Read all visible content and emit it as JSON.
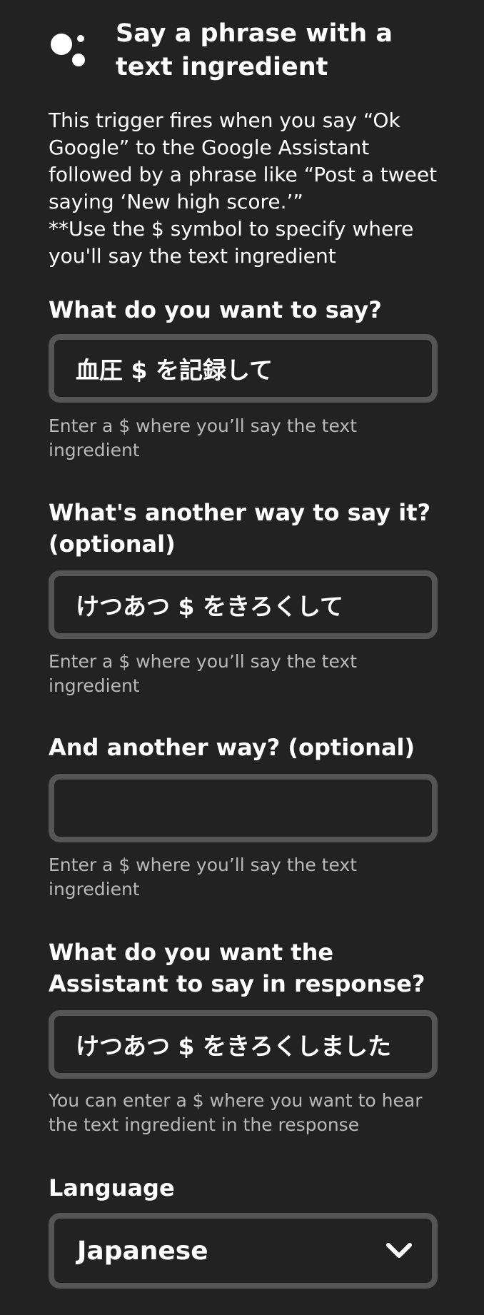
{
  "header": {
    "logo_icon": "google-assistant-dots-icon",
    "title": "Say a phrase with a text ingredient"
  },
  "description": "This trigger fires when you say “Ok Google” to the Google Assistant followed by a phrase like “Post a tweet saying ‘New high score.’”\n**Use the $ symbol to specify where you'll say the text ingredient",
  "fields": [
    {
      "label": "What do you want to say?",
      "value": "血圧 $ を記録して",
      "hint": "Enter a $ where you’ll say the text ingredient"
    },
    {
      "label": "What's another way to say it? (optional)",
      "value": "けつあつ $ をきろくして",
      "hint": "Enter a $ where you’ll say the text ingredient"
    },
    {
      "label": "And another way? (optional)",
      "value": "",
      "hint": "Enter a $ where you’ll say the text ingredient"
    },
    {
      "label": "What do you want the Assistant to say in response?",
      "value": "けつあつ $ をきろくしました",
      "hint": "You can enter a $ where you want to hear the text ingredient in the response"
    }
  ],
  "language": {
    "label": "Language",
    "selected": "Japanese",
    "icon": "chevron-down-icon"
  },
  "colors": {
    "background": "#222222",
    "border": "#555555",
    "hint_text": "#b9b9b9",
    "text": "#ffffff"
  }
}
